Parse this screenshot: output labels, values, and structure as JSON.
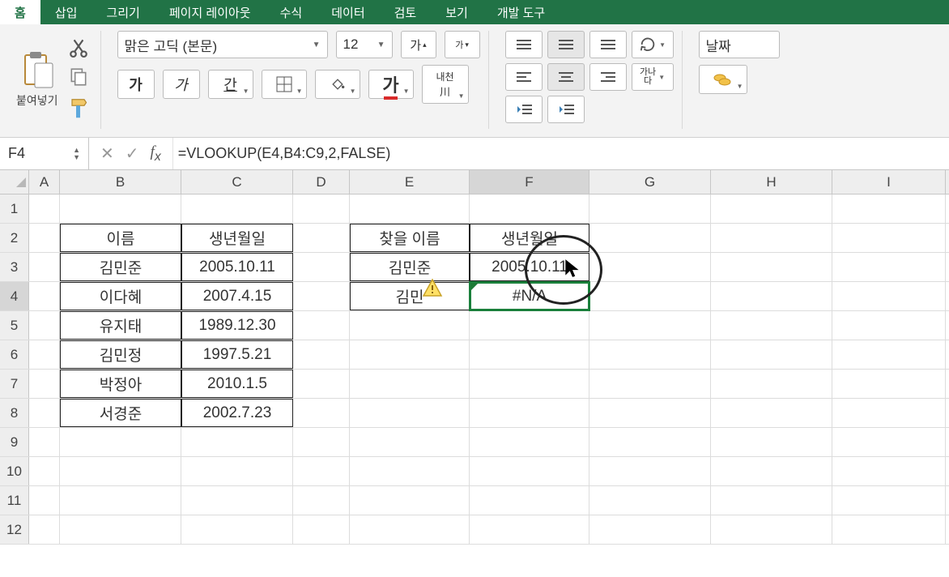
{
  "tabs": {
    "home": "홈",
    "insert": "삽입",
    "draw": "그리기",
    "pagelayout": "페이지 레이아웃",
    "formulas": "수식",
    "data": "데이터",
    "review": "검토",
    "view": "보기",
    "developer": "개발 도구"
  },
  "ribbon": {
    "paste_label": "붙여넣기",
    "font_name": "맑은 고딕 (본문)",
    "font_size": "12",
    "size_up": "가",
    "size_down": "가",
    "bold": "가",
    "italic": "가",
    "underline": "간",
    "font_color_char": "가",
    "ruby": "내천",
    "ruby_sub": "川",
    "ganada": "가나",
    "ganada_sub": "다",
    "number_format": "날짜"
  },
  "formula_bar": {
    "cell_ref": "F4",
    "formula": "=VLOOKUP(E4,B4:C9,2,FALSE)"
  },
  "columns": [
    "A",
    "B",
    "C",
    "D",
    "E",
    "F",
    "G",
    "H",
    "I"
  ],
  "row_numbers": [
    "1",
    "2",
    "3",
    "4",
    "5",
    "6",
    "7",
    "8",
    "9",
    "10",
    "11",
    "12"
  ],
  "table1": {
    "headers": {
      "name": "이름",
      "dob": "생년월일"
    },
    "rows": [
      {
        "name": "김민준",
        "dob": "2005.10.11"
      },
      {
        "name": "이다혜",
        "dob": "2007.4.15"
      },
      {
        "name": "유지태",
        "dob": "1989.12.30"
      },
      {
        "name": "김민정",
        "dob": "1997.5.21"
      },
      {
        "name": "박정아",
        "dob": "2010.1.5"
      },
      {
        "name": "서경준",
        "dob": "2002.7.23"
      }
    ]
  },
  "table2": {
    "headers": {
      "lookup": "찾을 이름",
      "dob": "생년월일"
    },
    "rows": [
      {
        "lookup": "김민준",
        "result": "2005.10.11"
      },
      {
        "lookup": "김민",
        "result": "#N/A"
      }
    ]
  }
}
